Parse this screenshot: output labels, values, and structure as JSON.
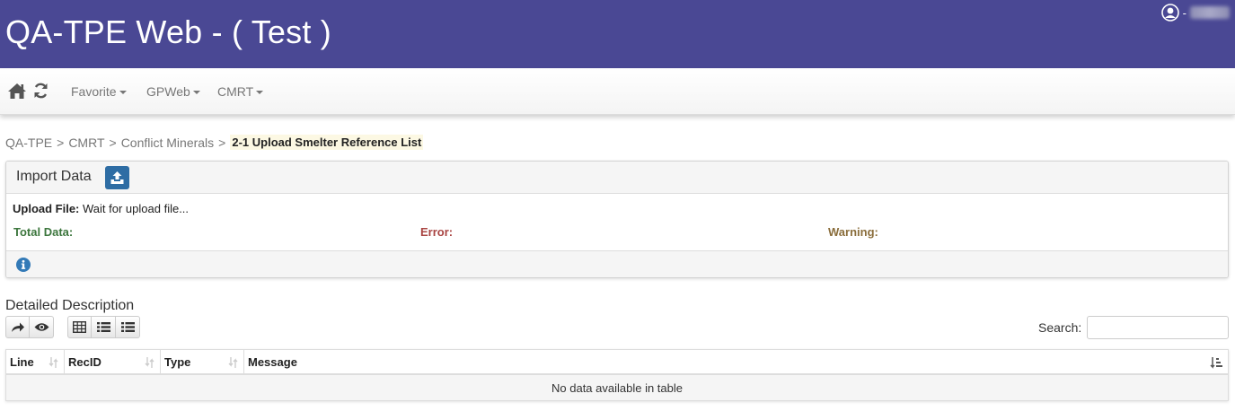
{
  "header": {
    "title": "QA-TPE Web - ( Test )",
    "user_separator": "-",
    "bg_color": "#4a4894"
  },
  "nav": {
    "icons": [
      "home-icon",
      "refresh-icon"
    ],
    "menus": [
      {
        "label": "Favorite"
      },
      {
        "label": "GPWeb"
      },
      {
        "label": "CMRT"
      }
    ]
  },
  "breadcrumb": {
    "items": [
      "QA-TPE",
      "CMRT",
      "Conflict Minerals"
    ],
    "separator": ">",
    "current": "2-1 Upload Smelter Reference List"
  },
  "import_panel": {
    "title": "Import Data",
    "upload_icon": "upload-icon",
    "upload_file_label": "Upload File:",
    "upload_file_status": "Wait for upload file...",
    "total_label": "Total Data:",
    "error_label": "Error:",
    "warning_label": "Warning:",
    "info_icon": "info-icon"
  },
  "detail": {
    "title": "Detailed Description",
    "search_label": "Search:",
    "search_value": "",
    "toolbar_icons": [
      "share-icon",
      "eye-icon",
      "grid-icon",
      "list-icon",
      "list-detail-icon"
    ]
  },
  "table": {
    "columns": [
      "Line",
      "RecID",
      "Type",
      "Message"
    ],
    "empty_message": "No data available in table"
  }
}
